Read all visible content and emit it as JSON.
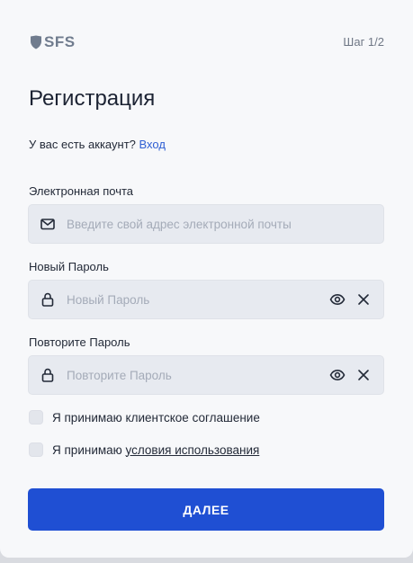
{
  "header": {
    "logo_text": "SFS",
    "step_label": "Шаг 1/2"
  },
  "form": {
    "title": "Регистрация",
    "have_account_text": "У вас есть аккаунт? ",
    "login_link": "Вход",
    "email": {
      "label": "Электронная почта",
      "placeholder": "Введите свой адрес электронной почты",
      "value": "",
      "icon": "mail-icon"
    },
    "password": {
      "label": "Новый Пароль",
      "placeholder": "Новый Пароль",
      "value": "",
      "icon": "lock-icon"
    },
    "repeat_password": {
      "label": "Повторите Пароль",
      "placeholder": "Повторите Пароль",
      "value": "",
      "icon": "lock-icon"
    },
    "agree_client": {
      "label": "Я принимаю клиентское соглашение",
      "checked": false
    },
    "agree_terms": {
      "label_prefix": "Я принимаю ",
      "link": "условия использования",
      "checked": false
    },
    "submit_label": "ДАЛЕЕ"
  },
  "colors": {
    "accent": "#1f4fd3",
    "link": "#2f5fd3",
    "field_bg": "#e7eaf0",
    "card_bg": "#f7f8fa"
  }
}
